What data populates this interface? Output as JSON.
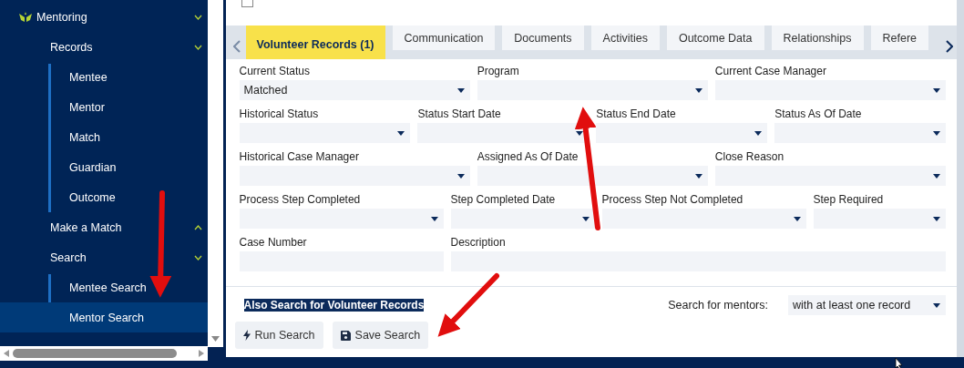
{
  "sidebar": {
    "items": [
      {
        "label": "Mentoring",
        "expanded": true,
        "selected": false,
        "children": [
          {
            "label": "Records",
            "expanded": true,
            "selected": false,
            "children": [
              {
                "label": "Mentee",
                "selected": false
              },
              {
                "label": "Mentor",
                "selected": false
              },
              {
                "label": "Match",
                "selected": false
              },
              {
                "label": "Guardian",
                "selected": false
              },
              {
                "label": "Outcome",
                "selected": false
              }
            ]
          },
          {
            "label": "Make a Match",
            "expanded": false,
            "selected": false
          },
          {
            "label": "Search",
            "expanded": true,
            "selected": false,
            "children": [
              {
                "label": "Mentee Search",
                "selected": false
              },
              {
                "label": "Mentor Search",
                "selected": true
              }
            ]
          }
        ]
      }
    ]
  },
  "top_checkbox": {
    "checked": false
  },
  "tabs": [
    {
      "label": "Volunteer Records (1)",
      "selected": true
    },
    {
      "label": "Communication",
      "selected": false
    },
    {
      "label": "Documents",
      "selected": false
    },
    {
      "label": "Activities",
      "selected": false
    },
    {
      "label": "Outcome Data",
      "selected": false
    },
    {
      "label": "Relationships",
      "selected": false
    },
    {
      "label": "Refere",
      "selected": false
    }
  ],
  "form_rows": [
    [
      {
        "label": "Current Status",
        "kind": "select",
        "value": "Matched"
      },
      {
        "label": "Program",
        "kind": "select"
      },
      {
        "label": "Current Case Manager",
        "kind": "select"
      }
    ],
    [
      {
        "label": "Historical Status",
        "kind": "select"
      },
      {
        "label": "Status Start Date",
        "kind": "select"
      },
      {
        "label": "Status End Date",
        "kind": "select"
      },
      {
        "label": "Status As Of Date",
        "kind": "select"
      }
    ],
    [
      {
        "label": "Historical Case Manager",
        "kind": "select"
      },
      {
        "label": "Assigned As Of Date",
        "kind": "select"
      },
      {
        "label": "Close Reason",
        "kind": "select"
      }
    ],
    [
      {
        "label": "Process Step Completed",
        "kind": "select"
      },
      {
        "label": "Step Completed Date",
        "kind": "select"
      },
      {
        "label": "Process Step Not Completed",
        "kind": "select"
      },
      {
        "label": "Step Required",
        "kind": "select"
      }
    ],
    [
      {
        "label": "Case Number",
        "kind": "text"
      },
      {
        "label": "Description",
        "kind": "text"
      }
    ]
  ],
  "also_search": {
    "label": "Also Search for Volunteer Records",
    "highlighted": true
  },
  "search_for": {
    "label": "Search for mentors:",
    "value": "with at least one record"
  },
  "buttons": [
    {
      "label": "Run Search",
      "kind": "run"
    },
    {
      "label": "Save Search",
      "kind": "save"
    }
  ]
}
